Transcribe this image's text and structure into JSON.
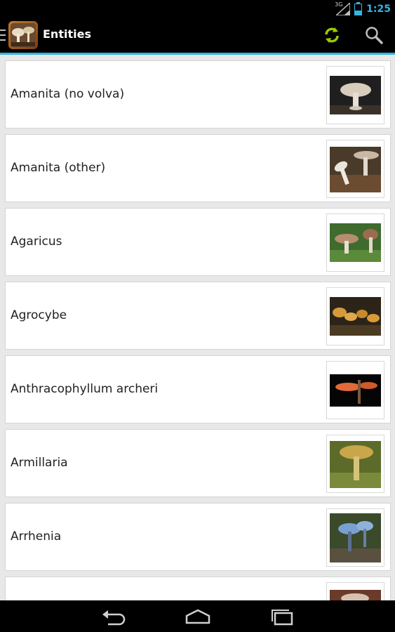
{
  "status_bar": {
    "network": "3G",
    "time": "1:25",
    "battery_level": 0.35,
    "accent_color": "#33b5e5"
  },
  "action_bar": {
    "title": "Entities",
    "refresh_icon": "refresh-icon",
    "search_icon": "search-icon"
  },
  "items": [
    {
      "label": "Amanita (no volva)"
    },
    {
      "label": "Amanita (other)"
    },
    {
      "label": "Agaricus"
    },
    {
      "label": "Agrocybe"
    },
    {
      "label": "Anthracophyllum archeri"
    },
    {
      "label": "Armillaria"
    },
    {
      "label": "Arrhenia"
    },
    {
      "label": ""
    }
  ],
  "nav_bar": {
    "back_icon": "back-icon",
    "home_icon": "home-icon",
    "recents_icon": "recent-apps-icon"
  }
}
